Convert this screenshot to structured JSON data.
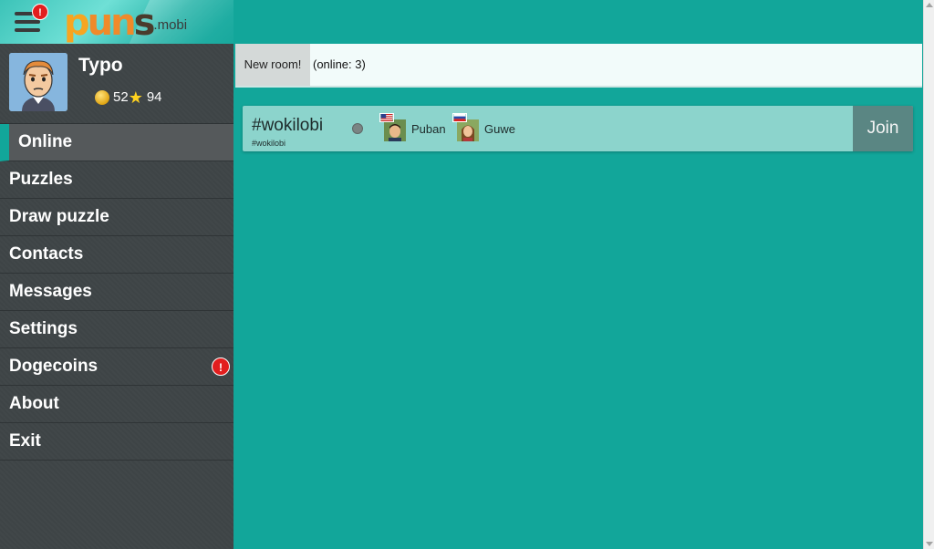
{
  "app": {
    "logo_main_1": "p",
    "logo_main_2": "un",
    "logo_main_3": "s",
    "logo_tld": ".mobi",
    "menu_badge": "!"
  },
  "profile": {
    "username": "Typo",
    "coins": "52",
    "stars": "94"
  },
  "sidebar": {
    "items": [
      {
        "label": "Online",
        "active": true
      },
      {
        "label": "Puzzles"
      },
      {
        "label": "Draw puzzle"
      },
      {
        "label": "Contacts"
      },
      {
        "label": "Messages"
      },
      {
        "label": "Settings"
      },
      {
        "label": "Dogecoins",
        "badge": "!"
      },
      {
        "label": "About"
      },
      {
        "label": "Exit"
      }
    ]
  },
  "main": {
    "new_room_label": "New room!",
    "online_count": "(online: 3)",
    "rooms": [
      {
        "name": "#wokilobi",
        "subtitle": "#wokilobi",
        "players": [
          {
            "name": "Puban",
            "flag": "us-flag"
          },
          {
            "name": "Guwe",
            "flag": "ru-flag"
          }
        ],
        "join_label": "Join"
      }
    ]
  },
  "colors": {
    "accent": "#12a69a",
    "sidebar": "#3e4446",
    "badge": "#e21e1e"
  }
}
